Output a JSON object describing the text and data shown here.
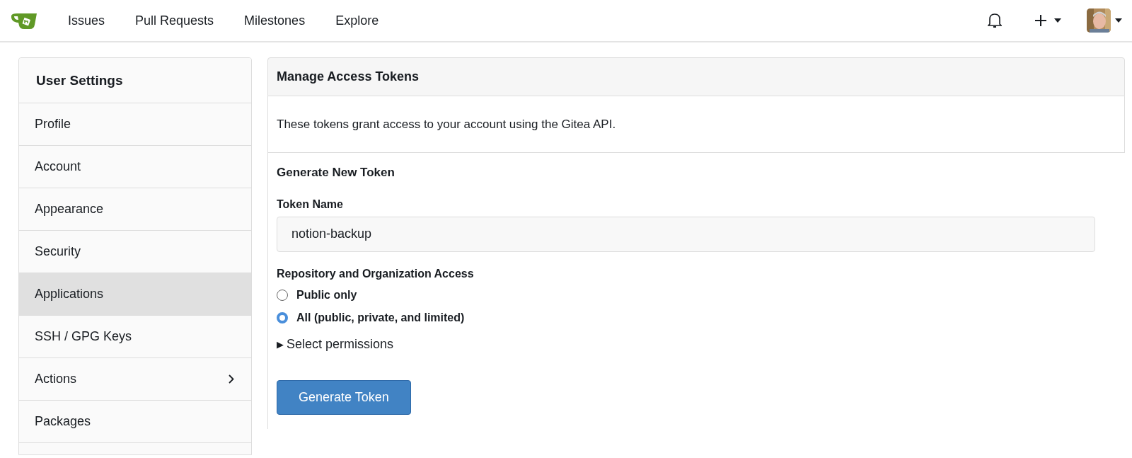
{
  "navbar": {
    "links": [
      "Issues",
      "Pull Requests",
      "Milestones",
      "Explore"
    ]
  },
  "sidebar": {
    "title": "User Settings",
    "items": [
      {
        "label": "Profile",
        "selected": false,
        "submenu": false
      },
      {
        "label": "Account",
        "selected": false,
        "submenu": false
      },
      {
        "label": "Appearance",
        "selected": false,
        "submenu": false
      },
      {
        "label": "Security",
        "selected": false,
        "submenu": false
      },
      {
        "label": "Applications",
        "selected": true,
        "submenu": false
      },
      {
        "label": "SSH / GPG Keys",
        "selected": false,
        "submenu": false
      },
      {
        "label": "Actions",
        "selected": false,
        "submenu": true
      },
      {
        "label": "Packages",
        "selected": false,
        "submenu": false
      }
    ]
  },
  "main": {
    "title": "Manage Access Tokens",
    "description": "These tokens grant access to your account using the Gitea API.",
    "form": {
      "title": "Generate New Token",
      "token_name_label": "Token Name",
      "token_name_value": "notion-backup",
      "access_label": "Repository and Organization Access",
      "options": [
        {
          "label": "Public only",
          "selected": false
        },
        {
          "label": "All (public, private, and limited)",
          "selected": true
        }
      ],
      "permissions": {
        "arrow": "▶",
        "label": "Select permissions",
        "expanded": false
      },
      "submit": "Generate Token"
    }
  }
}
